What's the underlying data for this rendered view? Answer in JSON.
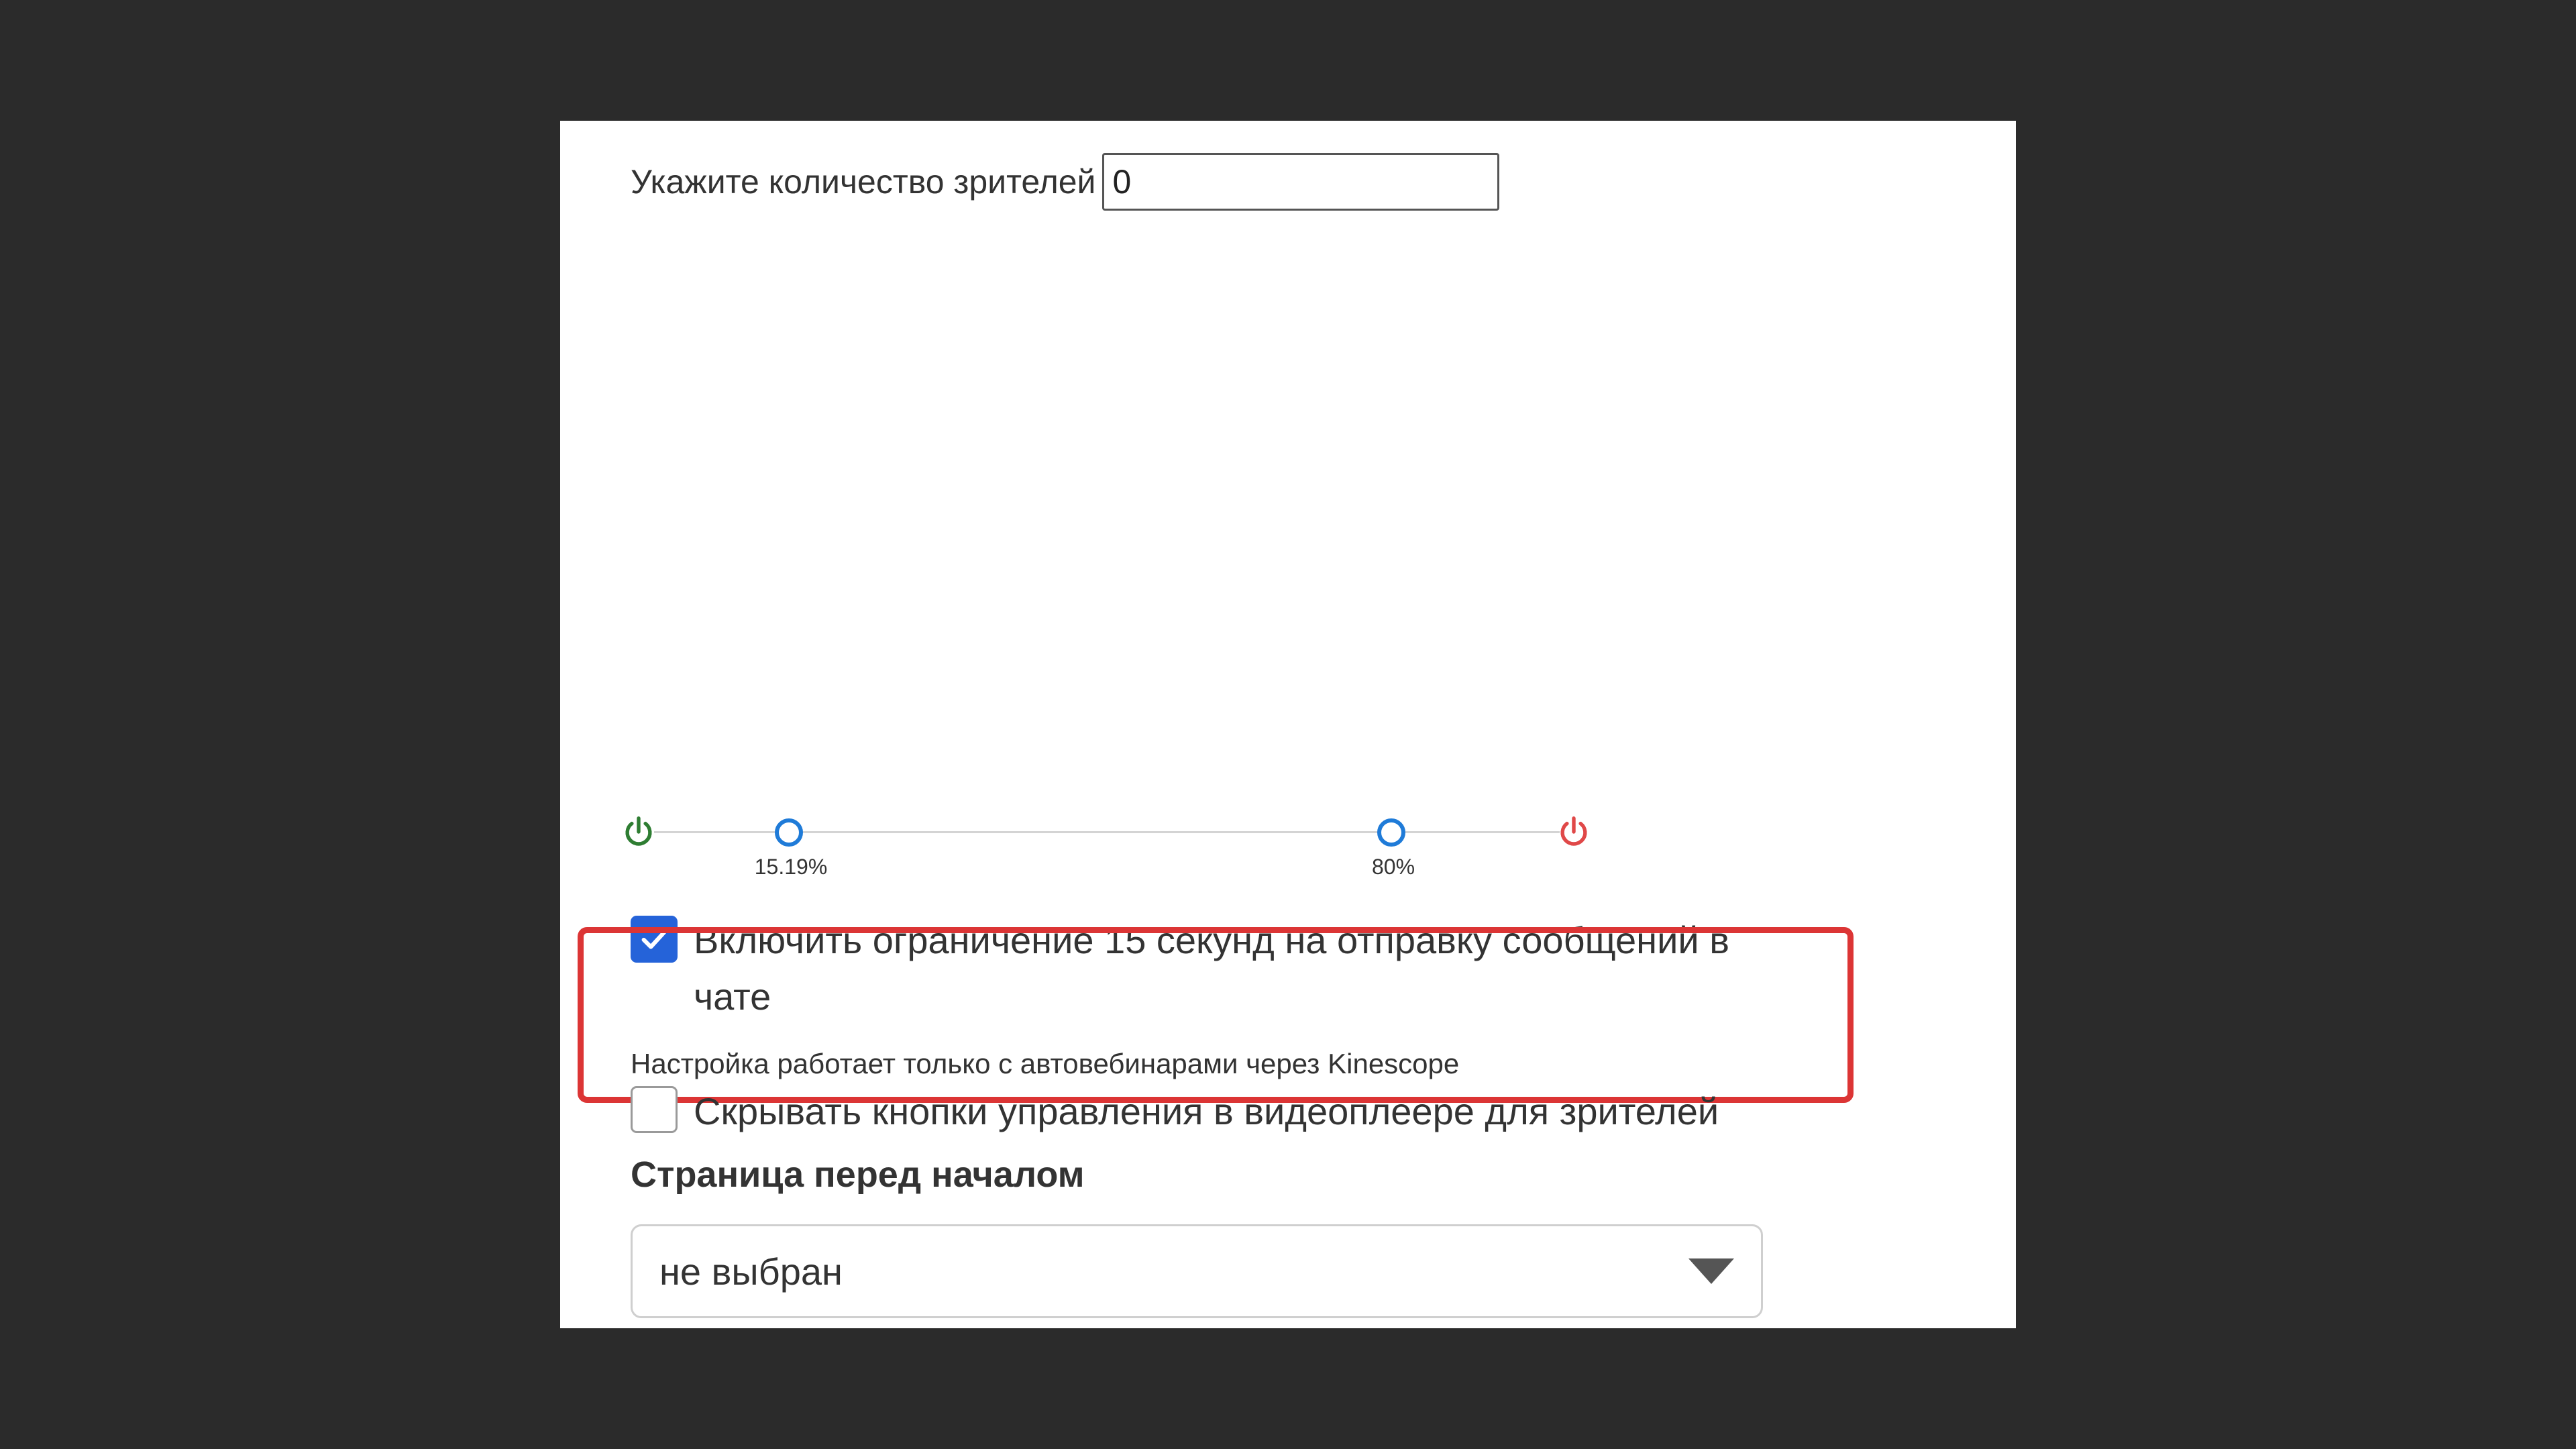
{
  "viewers": {
    "label": "Укажите количество зрителей",
    "value": "0"
  },
  "slider": {
    "start_icon": "power-icon",
    "end_icon": "power-icon",
    "start_color": "#2e7d32",
    "end_color": "#e04848",
    "handle_color": "#1f7bd8",
    "handles": [
      {
        "value": 15.19,
        "label": "15.19%"
      },
      {
        "value": 80,
        "label": "80%"
      }
    ]
  },
  "chat_limit": {
    "checked": true,
    "label": "Включить ограничение 15 секунд на отправку сообщений в чате"
  },
  "hide_controls": {
    "checked": false,
    "label": "Скрывать кнопки управления в видеоплеере для зрителей",
    "note": "Настройка работает только с автовебинарами через Kinescope"
  },
  "pre_start_page": {
    "title": "Страница перед началом",
    "selected": "не выбран"
  },
  "colors": {
    "accent": "#2563d9",
    "highlight": "#dc3535"
  }
}
